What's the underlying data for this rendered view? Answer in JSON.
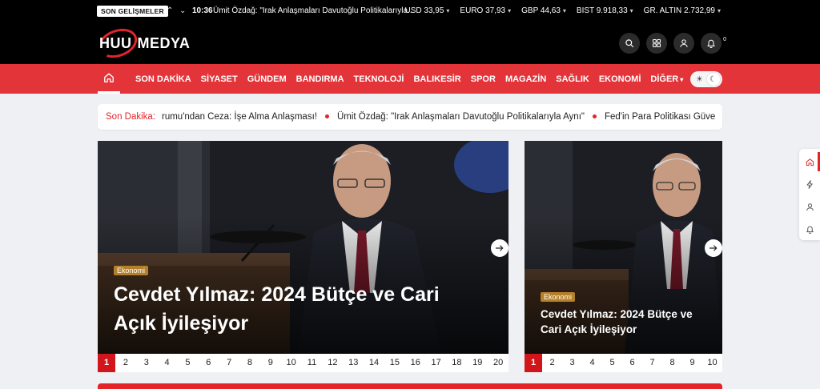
{
  "topbar": {
    "badge": "SON GELİŞMELER",
    "news_time": "10:36",
    "news_title": "Ümit Özdağ: \"Irak Anlaşmaları Davutoğlu Politikalarıyla...",
    "rates": [
      {
        "label": "USD 33,95"
      },
      {
        "label": "EURO 37,93"
      },
      {
        "label": "GBP 44,63"
      },
      {
        "label": "BIST 9.918,33"
      },
      {
        "label": "GR. ALTIN 2.732,99"
      }
    ]
  },
  "header": {
    "logo_left": "HUU",
    "logo_right": "MEDYA",
    "notification_count": "0"
  },
  "nav": {
    "items": [
      "SON DAKİKA",
      "SİYASET",
      "GÜNDEM",
      "BANDIRMA",
      "TEKNOLOJİ",
      "BALIKESİR",
      "SPOR",
      "MAGAZİN",
      "SAĞLIK",
      "EKONOMİ",
      "DİĞER"
    ]
  },
  "breaking": {
    "label": "Son Dakika:",
    "items": [
      "rumu'ndan Ceza: İşe Alma Anlaşması!",
      "Ümit Özdağ: \"Irak Anlaşmaları Davutoğlu Politikalarıyla Aynı\"",
      "Fed'in Para Politikası Güven"
    ]
  },
  "main_slider": {
    "category": "Ekonomi",
    "title": "Cevdet Yılmaz: 2024 Bütçe ve Cari Açık İyileşiyor",
    "pages": [
      "1",
      "2",
      "3",
      "4",
      "5",
      "6",
      "7",
      "8",
      "9",
      "10",
      "11",
      "12",
      "13",
      "14",
      "15",
      "16",
      "17",
      "18",
      "19",
      "20"
    ],
    "active_page": "1"
  },
  "side_slider": {
    "category": "Ekonomi",
    "title": "Cevdet Yılmaz: 2024 Bütçe ve Cari Açık İyileşiyor",
    "pages": [
      "1",
      "2",
      "3",
      "4",
      "5",
      "6",
      "7",
      "8",
      "9",
      "10"
    ],
    "active_page": "1"
  },
  "colors": {
    "brand_red": "#e3252a",
    "nav_red": "#e3343a",
    "category_gold": "#b5802a"
  }
}
